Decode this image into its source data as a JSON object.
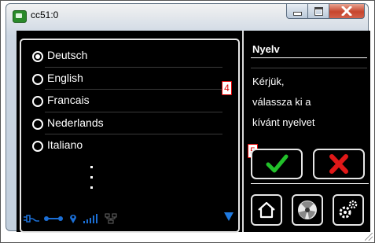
{
  "window": {
    "title": "cc51:0"
  },
  "languages": [
    {
      "label": "Deutsch",
      "selected": true
    },
    {
      "label": "English",
      "selected": false
    },
    {
      "label": "Francais",
      "selected": false
    },
    {
      "label": "Nederlands",
      "selected": false
    },
    {
      "label": "Italiano",
      "selected": false
    }
  ],
  "panel": {
    "title": "Nyelv",
    "message_lines": [
      "Kérjük,",
      "válassza ki a",
      "kívánt nyelvet"
    ]
  },
  "markers": {
    "list": "4",
    "confirm": "5"
  },
  "icons": {
    "status": [
      "plug-icon",
      "connection-icon",
      "location-icon",
      "signal-bars-icon",
      "network-icon"
    ],
    "scroll": "scroll-down-arrow-icon",
    "confirm": "checkmark-icon",
    "cancel": "x-icon",
    "nav": [
      "home-icon",
      "fan-icon",
      "settings-gears-icon"
    ]
  },
  "colors": {
    "accent_blue": "#1f7ae0",
    "confirm_green": "#22c02a",
    "cancel_red": "#e01818",
    "screen_bg": "#000000"
  }
}
